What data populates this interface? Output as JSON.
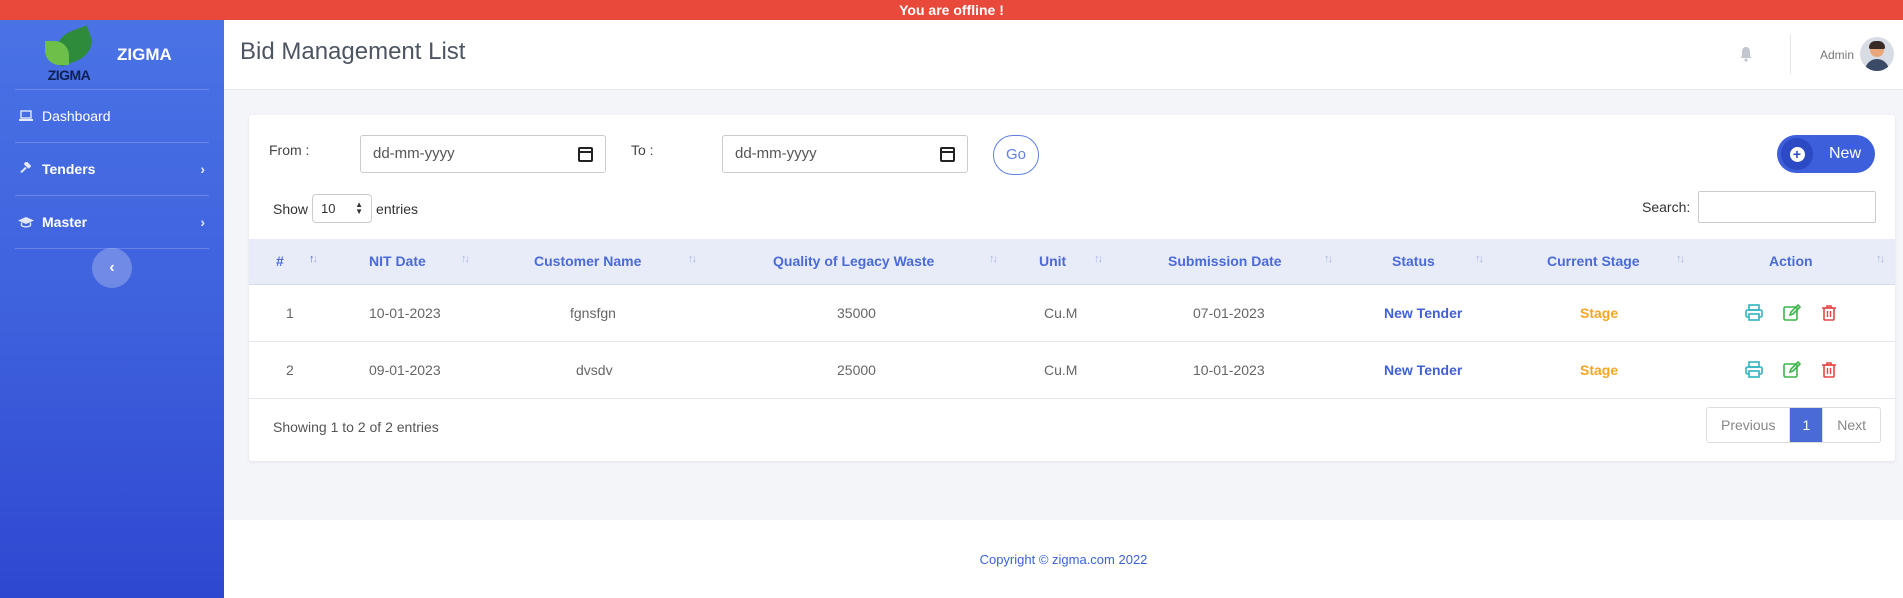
{
  "banner": {
    "text": "You are offline !"
  },
  "brand": {
    "logo_text": "ZIGMA",
    "name": "ZIGMA"
  },
  "sidebar": {
    "items": [
      {
        "label": "Dashboard",
        "icon": "laptop-icon"
      },
      {
        "label": "Tenders",
        "icon": "gavel-icon"
      },
      {
        "label": "Master",
        "icon": "graduation-cap-icon"
      }
    ]
  },
  "header": {
    "title": "Bid Management List",
    "user": "Admin"
  },
  "filters": {
    "from_label": "From :",
    "to_label": "To :",
    "from_placeholder": "dd-mm-yyyy",
    "to_placeholder": "dd-mm-yyyy",
    "go_label": "Go",
    "new_label": "New"
  },
  "table_controls": {
    "show_label": "Show",
    "entries_label": "entries",
    "page_length": "10",
    "search_label": "Search:"
  },
  "table": {
    "columns": [
      "#",
      "NIT Date",
      "Customer Name",
      "Quality of Legacy Waste",
      "Unit",
      "Submission Date",
      "Status",
      "Current Stage",
      "Action"
    ],
    "rows": [
      {
        "no": "1",
        "nit_date": "10-01-2023",
        "customer": "fgnsfgn",
        "quality": "35000",
        "unit": "Cu.M",
        "submission": "07-01-2023",
        "status": "New Tender",
        "stage": "Stage"
      },
      {
        "no": "2",
        "nit_date": "09-01-2023",
        "customer": "dvsdv",
        "quality": "25000",
        "unit": "Cu.M",
        "submission": "10-01-2023",
        "status": "New Tender",
        "stage": "Stage"
      }
    ]
  },
  "pagination": {
    "info": "Showing 1 to 2 of 2 entries",
    "previous": "Previous",
    "current": "1",
    "next": "Next"
  },
  "footer": {
    "text": "Copyright © zigma.com 2022"
  },
  "colors": {
    "offline": "#e8493b",
    "sidebar": "#3d5fdc",
    "accent": "#4a6ad8",
    "status": "#4060d6",
    "stage": "#f5a623",
    "print_icon": "#2bb5c2",
    "edit_icon": "#3bb54a",
    "delete_icon": "#e64545"
  }
}
